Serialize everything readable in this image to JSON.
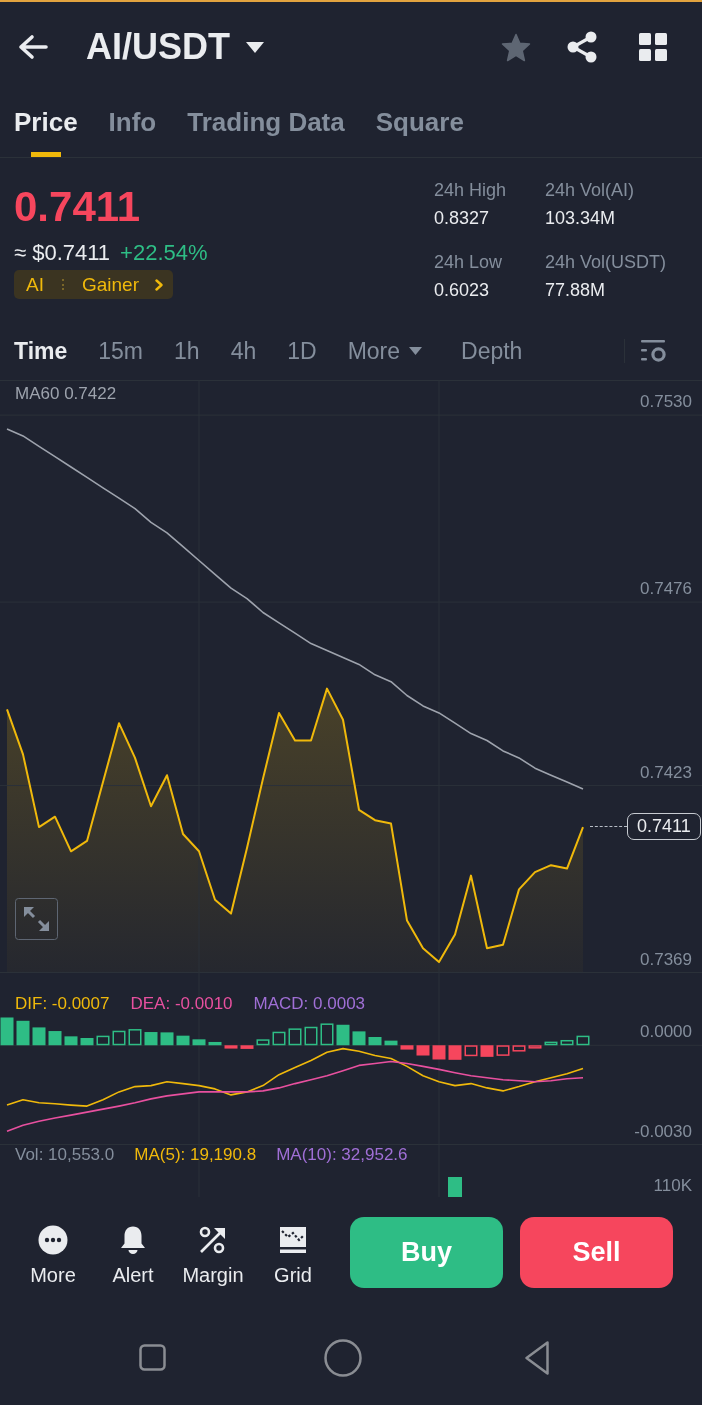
{
  "header": {
    "title": "AI/USDT"
  },
  "tabs": [
    {
      "label": "Price",
      "selected": true
    },
    {
      "label": "Info",
      "selected": false
    },
    {
      "label": "Trading Data",
      "selected": false
    },
    {
      "label": "Square",
      "selected": false
    }
  ],
  "ticker": {
    "last_price": "0.7411",
    "usd_price": "≈ $0.7411",
    "change": "+22.54%",
    "tags": [
      "AI",
      "Gainer"
    ],
    "stats": [
      {
        "label": "24h High",
        "value": "0.8327"
      },
      {
        "label": "24h Vol(AI)",
        "value": "103.34M"
      },
      {
        "label": "24h Low",
        "value": "0.6023"
      },
      {
        "label": "24h Vol(USDT)",
        "value": "77.88M"
      }
    ]
  },
  "intervals": [
    {
      "label": "Time",
      "selected": true,
      "kind": "interval"
    },
    {
      "label": "15m",
      "selected": false,
      "kind": "interval"
    },
    {
      "label": "1h",
      "selected": false,
      "kind": "interval"
    },
    {
      "label": "4h",
      "selected": false,
      "kind": "interval"
    },
    {
      "label": "1D",
      "selected": false,
      "kind": "interval"
    },
    {
      "label": "More",
      "selected": false,
      "kind": "menu"
    },
    {
      "label": "Depth",
      "selected": false,
      "kind": "view"
    }
  ],
  "price_chart": {
    "legend": "MA60 0.7422",
    "price_tag": "0.7411",
    "chart_data": {
      "type": "line",
      "grid": true,
      "ylim": [
        0.7369,
        0.754
      ],
      "yticks": [
        {
          "value": 0.753,
          "label": "0.7530"
        },
        0.7476,
        0.7423,
        0.7369
      ],
      "series": [
        {
          "color": "#f0b90b",
          "values": [
            0.7445,
            0.7432,
            0.7411,
            0.7414,
            0.7404,
            0.7407,
            0.7424,
            0.7441,
            0.7431,
            0.7417,
            0.7426,
            0.7409,
            0.7404,
            0.739,
            0.7386,
            0.7405,
            0.7425,
            0.7444,
            0.7436,
            0.7436,
            0.7451,
            0.7442,
            0.7416,
            0.7413,
            0.7412,
            0.7384,
            0.7376,
            0.7372,
            0.738,
            0.7397,
            0.7376,
            0.7377,
            0.7393,
            0.7398,
            0.74,
            0.7399,
            0.7411
          ]
        },
        {
          "color": "#9ea3ad",
          "values": [
            0.7526,
            0.7524,
            0.7521,
            0.7518,
            0.7515,
            0.7512,
            0.7509,
            0.7506,
            0.7503,
            0.7499,
            0.7496,
            0.7492,
            0.7488,
            0.7484,
            0.748,
            0.7477,
            0.7473,
            0.747,
            0.7467,
            0.7464,
            0.7462,
            0.746,
            0.7458,
            0.7455,
            0.7453,
            0.7449,
            0.7446,
            0.7444,
            0.7441,
            0.7438,
            0.7436,
            0.7433,
            0.7431,
            0.7428,
            0.7426,
            0.7424,
            0.7422
          ]
        }
      ]
    }
  },
  "macd_chart": {
    "legend": [
      {
        "text": "DIF: -0.0007",
        "color": "#f0b90b"
      },
      {
        "text": "DEA: -0.0010",
        "color": "#e8509f"
      },
      {
        "text": "MACD: 0.0003",
        "color": "#a06fd6"
      }
    ],
    "chart_data": {
      "type": "bar",
      "grid": true,
      "ylim": [
        -0.003,
        0.0022
      ],
      "yticks": [
        {
          "value": 0,
          "label": "0.0000"
        },
        {
          "value": -0.003,
          "label": "-0.0030"
        }
      ],
      "series": [
        {
          "color": "#2ebd85",
          "values": [
            0.00084,
            0.00074,
            0.00054,
            0.00043,
            0.00027,
            0.00022,
            0.00029,
            0.00044,
            0.00049,
            0.0004,
            0.00039,
            0.00029,
            0.00018,
            0.0001,
            null,
            null,
            0.00018,
            0.00041,
            0.00051,
            0.00056,
            0.00066,
            0.00062,
            0.00042,
            0.00025,
            0.00014,
            null,
            null,
            null,
            null,
            null,
            null,
            null,
            null,
            null,
            0.00011,
            0.00016,
            0.00029
          ]
        },
        {
          "color": "#f6465d",
          "values": [
            null,
            null,
            null,
            null,
            null,
            null,
            null,
            null,
            null,
            null,
            null,
            null,
            null,
            null,
            -0.0001,
            -0.00011,
            null,
            null,
            null,
            null,
            null,
            null,
            null,
            null,
            null,
            -0.00013,
            -0.00031,
            -0.00043,
            -0.00044,
            -0.00033,
            -0.00035,
            -0.00032,
            -0.00019,
            -0.0001,
            null,
            null,
            null
          ]
        },
        {
          "type": "line",
          "color": "#f0b90b",
          "values": [
            -0.00181,
            -0.00165,
            -0.00174,
            -0.00177,
            -0.00181,
            -0.00184,
            -0.00165,
            -0.00141,
            -0.00125,
            -0.00122,
            -0.0011,
            -0.00116,
            -0.00122,
            -0.00132,
            -0.0015,
            -0.00141,
            -0.00122,
            -0.00089,
            -0.00067,
            -0.00046,
            -0.00021,
            -0.0001,
            -0.00018,
            -0.00031,
            -0.0004,
            -0.00064,
            -0.00092,
            -0.0011,
            -0.00122,
            -0.00116,
            -0.00129,
            -0.00138,
            -0.00125,
            -0.0011,
            -0.00098,
            -0.00086,
            -0.0007
          ]
        },
        {
          "type": "line",
          "color": "#e8509f",
          "values": [
            -0.0026,
            -0.00242,
            -0.0023,
            -0.0022,
            -0.00211,
            -0.00202,
            -0.00193,
            -0.00184,
            -0.00174,
            -0.00162,
            -0.00153,
            -0.00147,
            -0.00141,
            -0.00141,
            -0.00141,
            -0.00141,
            -0.00138,
            -0.00129,
            -0.00116,
            -0.00104,
            -0.00092,
            -0.00077,
            -0.00061,
            -0.00055,
            -0.00049,
            -0.00055,
            -0.00064,
            -0.00073,
            -0.00083,
            -0.00092,
            -0.00098,
            -0.00104,
            -0.00107,
            -0.0011,
            -0.00107,
            -0.00101,
            -0.00098
          ]
        }
      ]
    }
  },
  "volume_chart": {
    "legend": [
      {
        "text": "Vol: 10,553.0",
        "color": "#848e9c"
      },
      {
        "text": "MA(5): 19,190.8",
        "color": "#f0b90b"
      },
      {
        "text": "MA(10): 32,952.6",
        "color": "#a06fd6"
      }
    ],
    "axis_label": "110K"
  },
  "actions": [
    {
      "label": "More",
      "kind": "more"
    },
    {
      "label": "Alert",
      "kind": "alert"
    },
    {
      "label": "Margin",
      "kind": "margin"
    },
    {
      "label": "Grid",
      "kind": "grid"
    }
  ],
  "trade_buttons": [
    {
      "label": "Buy",
      "kind": "buy"
    },
    {
      "label": "Sell",
      "kind": "sell"
    }
  ]
}
